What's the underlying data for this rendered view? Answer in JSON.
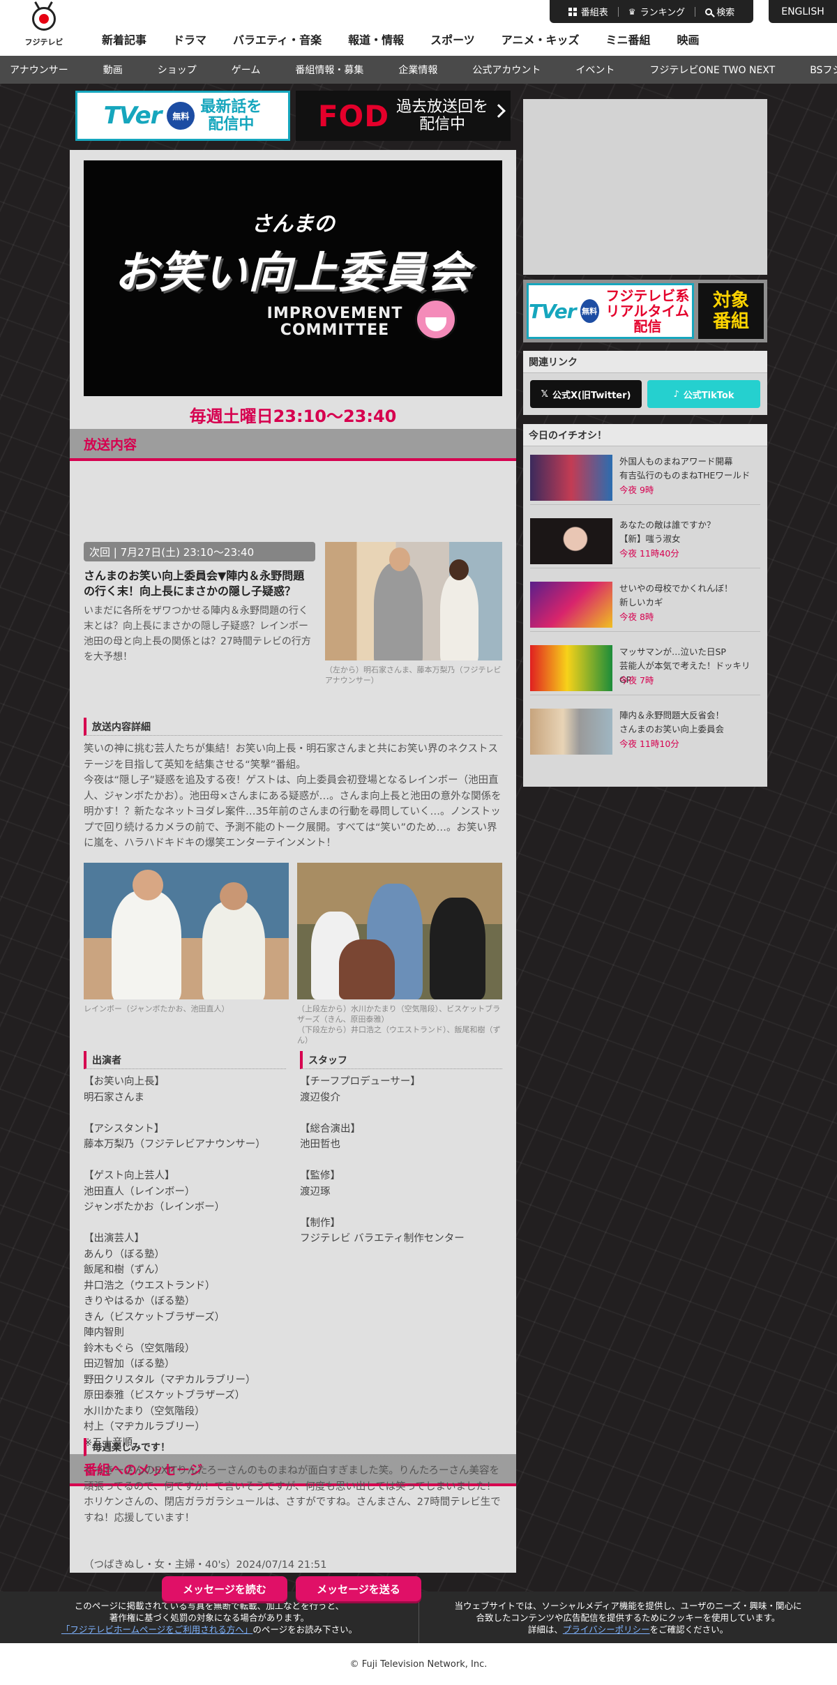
{
  "header": {
    "logo_text": "フジテレビ",
    "nav": [
      "新着記事",
      "ドラマ",
      "バラエティ・音楽",
      "報道・情報",
      "スポーツ",
      "アニメ・キッズ",
      "ミニ番組",
      "映画"
    ],
    "utility": {
      "schedule": "番組表",
      "ranking": "ランキング",
      "search": "検索"
    },
    "english": "ENGLISH"
  },
  "subnav": [
    "アナウンサー",
    "動画",
    "ショップ",
    "ゲーム",
    "番組情報・募集",
    "企業情報",
    "公式アカウント",
    "イベント",
    "フジテレビONE TWO NEXT",
    "BSフジ"
  ],
  "banners": {
    "tver": {
      "logo": "TVer",
      "badge": "無料",
      "line1": "最新話を",
      "line2": "配信中"
    },
    "fod": {
      "logo": "FOD",
      "line1": "過去放送回を",
      "line2": "配信中"
    }
  },
  "hero": {
    "small": "さんまの",
    "main": "お笑い向上委員会",
    "sub1": "IMPROVEMENT",
    "sub2": "COMMITTEE"
  },
  "airtime": "毎週土曜日23:10～23:40",
  "broadcast": {
    "heading": "放送内容",
    "next_badge": "次回 | 7月27日(土) 23:10～23:40",
    "title": "さんまのお笑い向上委員会▼陣内＆永野問題の行く末！向上長にまさかの隠し子疑惑？",
    "desc": "いまだに各所をザワつかせる陣内＆永野問題の行く末とは？向上長にまさかの隠し子疑惑？レインボー池田の母と向上長の関係とは？27時間テレビの行方を大予想！",
    "photo1_caption": "（左から）明石家さんま、藤本万梨乃（フジテレビアナウンサー）",
    "detail_heading": "放送内容詳細",
    "detail": "笑いの神に挑む芸人たちが集結！お笑い向上長・明石家さんまと共にお笑い界のネクストステージを目指して英知を結集させる“笑撃”番組。\n今夜は“隠し子”疑惑を追及する夜！ゲストは、向上委員会初登場となるレインボー（池田直人、ジャンボたかお）。池田母×さんまにある疑惑が…。さんま向上長と池田の意外な関係を明かす！？新たなネットヨダレ案件…35年前のさんまの行動を尋問していく…。ノンストップで回り続けるカメラの前で、予測不能のトーク展開。すべては“笑い”のため…。お笑い界に嵐を、ハラハドキドキの爆笑エンターテインメント！",
    "photo2_caption": "レインボー（ジャンボたかお、池田直人）",
    "photo3_caption": "（上段左から）水川かたまり（空気階段）、ビスケットブラザーズ（きん、原田泰雅）\n（下段左から）井口浩之（ウエストランド）、飯尾和樹（ずん）"
  },
  "cast": {
    "heading": "出演者",
    "text": "【お笑い向上長】\n明石家さんま\n\n【アシスタント】\n藤本万梨乃（フジテレビアナウンサー）\n\n【ゲスト向上芸人】\n池田直人（レインボー）\nジャンボたかお（レインボー）\n\n【出演芸人】\nあんり（ぼる塾）\n飯尾和樹（ずん）\n井口浩之（ウエストランド）\nきりやはるか（ぼる塾）\nきん（ビスケットブラザーズ）\n陣内智則\n鈴木もぐら（空気階段）\n田辺智加（ぼる塾）\n野田クリスタル（マヂカルラブリー）\n原田泰雅（ビスケットブラザーズ）\n水川かたまり（空気階段）\n村上（マヂカルラブリー）\n※五十音順"
  },
  "staff": {
    "heading": "スタッフ",
    "text": "【チーフプロデューサー】\n渡辺俊介\n\n【総合演出】\n池田哲也\n\n【監修】\n渡辺琢\n\n【制作】\nフジテレビ バラエティ制作センター"
  },
  "message": {
    "heading": "番組へのメッセージ",
    "sub_heading": "毎週楽しみです！",
    "text": "くっきーさんのEXITりんたろーさんのものまねが面白すぎました笑。りんたろーさん美容を頑張ってるので、何ですか！て言いそうですが、何度も思い出しては笑ってしまいました！ホリケンさんの、閉店ガラガラシュールは、さすがですね。さんまさん、27時間テレビ生ですね！応援しています！",
    "meta": "（つばきぬし・女・主婦・40's）2024/07/14 21:51",
    "read_btn": "メッセージを読む",
    "send_btn": "メッセージを送る"
  },
  "sidebar": {
    "tver_banner": {
      "logo": "TVer",
      "badge": "無料",
      "line1": "フジテレビ系",
      "line2": "リアルタイム配信",
      "right1": "対象",
      "right2": "番組"
    },
    "links": {
      "title": "関連リンク",
      "x": "公式X(旧Twitter)",
      "tiktok": "公式TikTok"
    },
    "picks": {
      "title": "今日のイチオシ！",
      "items": [
        {
          "line1": "外国人ものまねアワード開幕",
          "line2": "有吉弘行のものまねTHEワールド",
          "time": "今夜 9時"
        },
        {
          "line1": "あなたの敵は誰ですか？",
          "line2": "【新】嗤う淑女",
          "time": "今夜 11時40分"
        },
        {
          "line1": "せいやの母校でかくれんぼ！",
          "line2": "新しいカギ",
          "time": "今夜 8時"
        },
        {
          "line1": "マッサマンが…泣いた日SP",
          "line2": "芸能人が本気で考えた！ドッキリGP",
          "time": "今夜 7時"
        },
        {
          "line1": "陣内＆永野問題大反省会！",
          "line2": "さんまのお笑い向上委員会",
          "time": "今夜 11時10分"
        }
      ]
    }
  },
  "footer": {
    "left1": "このページに掲載されている写真を無断で転載、加工などを行うと、",
    "left2": "著作権に基づく処罰の対象になる場合があります。",
    "left_link": "「フジテレビホームページをご利用される方へ」",
    "left3": "のページをお読み下さい。",
    "right1": "当ウェブサイトでは、ソーシャルメディア機能を提供し、ユーザのニーズ・興味・関心に",
    "right2": "合致したコンテンツや広告配信を提供するためにクッキーを使用しています。",
    "right3a": "詳細は、",
    "right_link": "プライバシーポリシー",
    "right3b": "をご確認ください。",
    "copyright": "© Fuji Television Network, Inc."
  }
}
